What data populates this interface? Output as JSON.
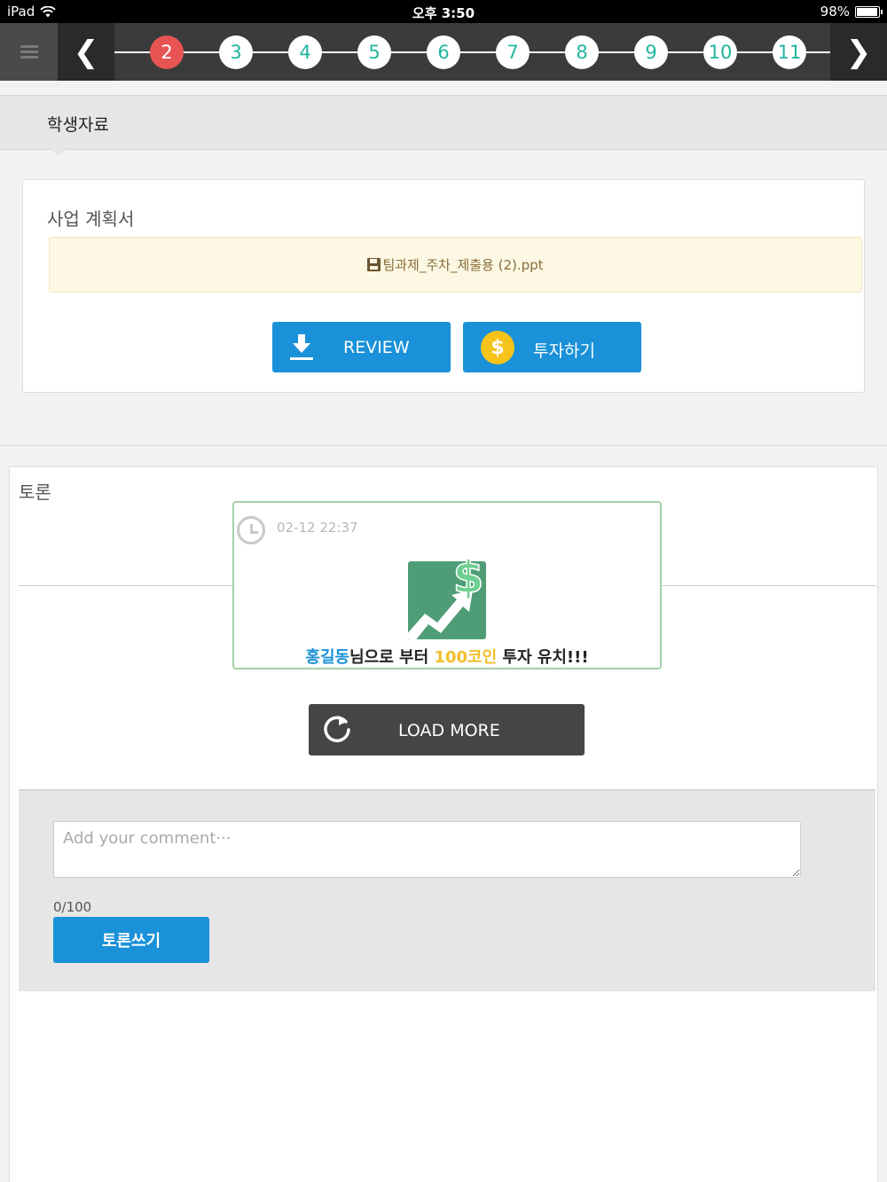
{
  "status_bar": {
    "device": "iPad",
    "time": "오후 3:50",
    "battery": "98%",
    "battery_level": 0.98
  },
  "nav": {
    "prev_glyph": "❮",
    "next_glyph": "❯",
    "steps": [
      "2",
      "3",
      "4",
      "5",
      "6",
      "7",
      "8",
      "9",
      "10",
      "11"
    ],
    "active_step": "2"
  },
  "section": {
    "title": "학생자료"
  },
  "plan": {
    "title": "사업 계획서",
    "file_name": "팀과제_주차_제출용 (2).ppt",
    "review_label": "REVIEW",
    "invest_label": "투자하기",
    "coin_glyph": "$"
  },
  "discussion": {
    "title": "토론",
    "post": {
      "time": "02-12 22:37",
      "name": "홍길동",
      "text_1": "님으로 부터 ",
      "coins": "100코인",
      "text_2": " 투자 유치!!!"
    },
    "load_more_label": "LOAD MORE",
    "comment_placeholder": "Add your comment···",
    "counter": "0/100",
    "submit_label": "토론쓰기"
  },
  "colors": {
    "accent_blue": "#1a91d8",
    "active_step": "#e85454",
    "step_text": "#21b5a0",
    "coin_yellow": "#f6c31b"
  }
}
